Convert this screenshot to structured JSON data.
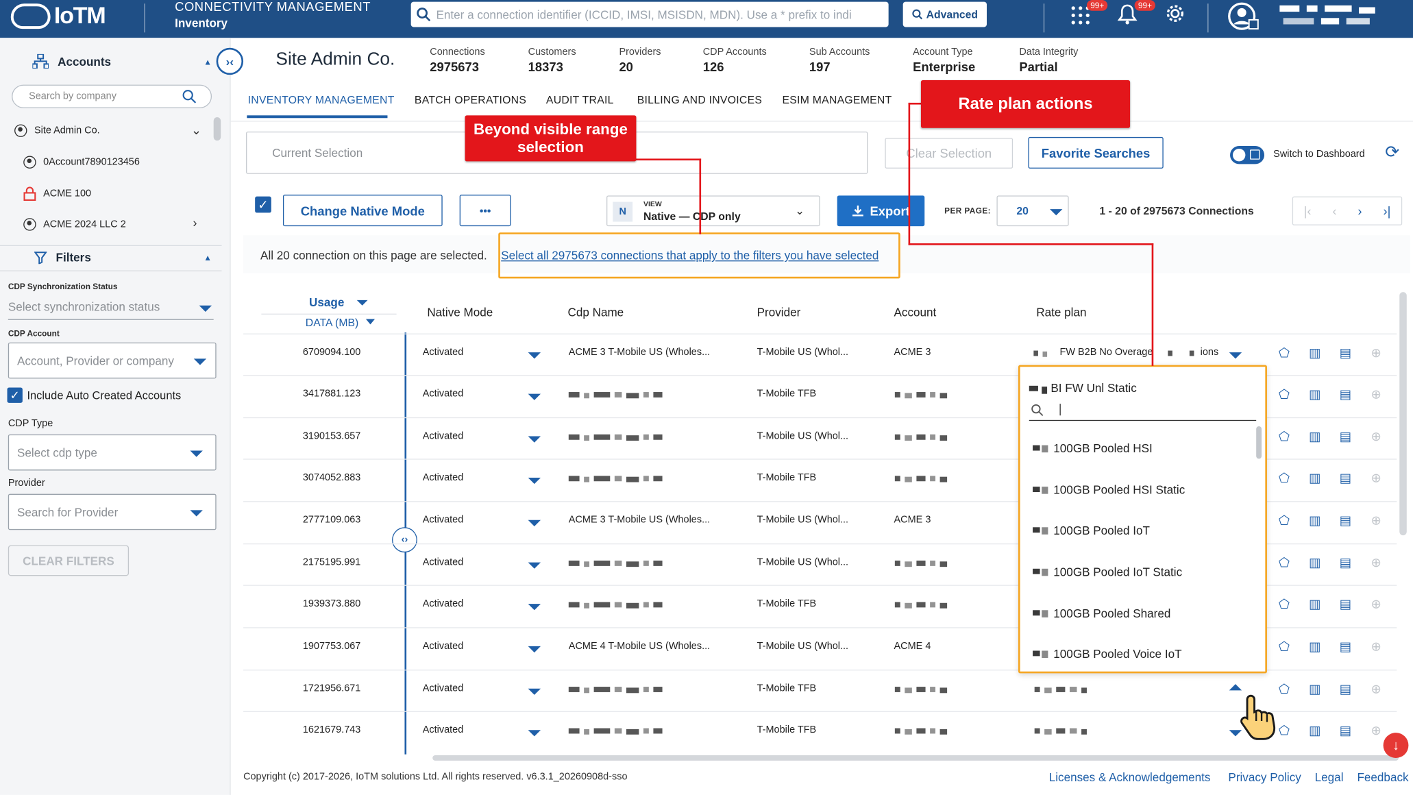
{
  "header": {
    "brand": "IoTM",
    "title": "CONNECTIVITY MANAGEMENT",
    "subtitle": "Inventory",
    "search_placeholder": "Enter a connection identifier (ICCID, IMSI, MSISDN, MDN). Use a * prefix to indi",
    "advanced_label": "Advanced",
    "apps_badge": "99+",
    "notif_badge": "99+"
  },
  "sidebar": {
    "accounts_title": "Accounts",
    "search_placeholder": "Search by company",
    "accounts": [
      {
        "name": "Site Admin Co.",
        "icon": "user-icon"
      },
      {
        "name": "0Account7890123456",
        "icon": "user-icon"
      },
      {
        "name": "ACME 100",
        "icon": "lock-icon"
      },
      {
        "name": "ACME 2024 LLC 2",
        "icon": "user-icon"
      }
    ],
    "filters_title": "Filters",
    "cdp_sync_label": "CDP Synchronization Status",
    "cdp_sync_placeholder": "Select synchronization status",
    "cdp_account_label": "CDP Account",
    "cdp_account_placeholder": "Account, Provider or company",
    "include_auto_label": "Include Auto Created Accounts",
    "cdp_type_label": "CDP Type",
    "cdp_type_placeholder": "Select cdp type",
    "provider_label": "Provider",
    "provider_placeholder": "Search for Provider",
    "clear_filters": "CLEAR FILTERS"
  },
  "company": "Site Admin Co.",
  "stats": [
    {
      "k": "Connections",
      "v": "2975673"
    },
    {
      "k": "Customers",
      "v": "18373"
    },
    {
      "k": "Providers",
      "v": "20"
    },
    {
      "k": "CDP Accounts",
      "v": "126"
    },
    {
      "k": "Sub Accounts",
      "v": "197"
    },
    {
      "k": "Account Type",
      "v": "Enterprise"
    },
    {
      "k": "Data Integrity",
      "v": "Partial"
    }
  ],
  "tabs": [
    "INVENTORY MANAGEMENT",
    "BATCH OPERATIONS",
    "AUDIT TRAIL",
    "BILLING AND INVOICES",
    "ESIM MANAGEMENT"
  ],
  "toolbar": {
    "current_selection": "Current Selection",
    "clear_selection": "Clear Selection",
    "favorite_searches": "Favorite Searches",
    "switch_dashboard": "Switch to Dashboard",
    "change_native": "Change Native Mode",
    "more": "•••",
    "view_label": "VIEW",
    "view_badge": "N",
    "view_value": "Native — CDP only",
    "export": "Export",
    "per_page_label": "PER PAGE:",
    "per_page_value": "20",
    "range": "1 - 20 of 2975673 Connections"
  },
  "banner": {
    "text": "All 20 connection on this page are selected.",
    "link": "Select all 2975673 connections that apply to the filters you have selected"
  },
  "callouts": {
    "beyond": "Beyond visible range selection",
    "rate": "Rate plan actions"
  },
  "columns": {
    "usage": "Usage",
    "usage_sub": "DATA (MB)",
    "native": "Native Mode",
    "cdp": "Cdp Name",
    "provider": "Provider",
    "account": "Account",
    "rate": "Rate plan"
  },
  "rows": [
    {
      "usage": "6709094.100",
      "native": "Activated",
      "cdp": "ACME 3 T-Mobile US (Wholes...",
      "provider": "T-Mobile US (Whol...",
      "account": "ACME 3",
      "rate": "FW B2B No Overage",
      "rate_tail": "ions"
    },
    {
      "usage": "3417881.123",
      "native": "Activated",
      "cdp": "",
      "provider": "T-Mobile TFB",
      "account": "",
      "rate": ""
    },
    {
      "usage": "3190153.657",
      "native": "Activated",
      "cdp": "",
      "provider": "T-Mobile US (Whol...",
      "account": "",
      "rate": ""
    },
    {
      "usage": "3074052.883",
      "native": "Activated",
      "cdp": "",
      "provider": "T-Mobile TFB",
      "account": "",
      "rate": ""
    },
    {
      "usage": "2777109.063",
      "native": "Activated",
      "cdp": "ACME 3 T-Mobile US (Wholes...",
      "provider": "T-Mobile US (Whol...",
      "account": "ACME 3",
      "rate": ""
    },
    {
      "usage": "2175195.991",
      "native": "Activated",
      "cdp": "",
      "provider": "T-Mobile US (Whol...",
      "account": "",
      "rate": ""
    },
    {
      "usage": "1939373.880",
      "native": "Activated",
      "cdp": "",
      "provider": "T-Mobile TFB",
      "account": "",
      "rate": ""
    },
    {
      "usage": "1907753.067",
      "native": "Activated",
      "cdp": "ACME 4 T-Mobile US (Wholes...",
      "provider": "T-Mobile US (Whol...",
      "account": "ACME 4",
      "rate": ""
    },
    {
      "usage": "1721956.671",
      "native": "Activated",
      "cdp": "",
      "provider": "T-Mobile TFB",
      "account": "",
      "rate": ""
    },
    {
      "usage": "1621679.743",
      "native": "Activated",
      "cdp": "",
      "provider": "T-Mobile TFB",
      "account": "",
      "rate": ""
    }
  ],
  "rate_dropdown": {
    "selected": "BI FW Unl Static",
    "options": [
      "100GB Pooled HSI",
      "100GB Pooled HSI Static",
      "100GB Pooled IoT",
      "100GB Pooled IoT Static",
      "100GB Pooled Shared",
      "100GB Pooled Voice IoT"
    ]
  },
  "footer": {
    "copyright": "Copyright (c) 2017-2026, IoTM solutions Ltd. All rights reserved. v6.3.1_20260908d-sso",
    "links": [
      "Licenses & Acknowledgements",
      "Privacy Policy",
      "Legal",
      "Feedback"
    ]
  },
  "colors": {
    "primary": "#1f4f86",
    "accent": "#1f5fa8",
    "callout": "#e3161b",
    "highlight": "#f5a623"
  }
}
